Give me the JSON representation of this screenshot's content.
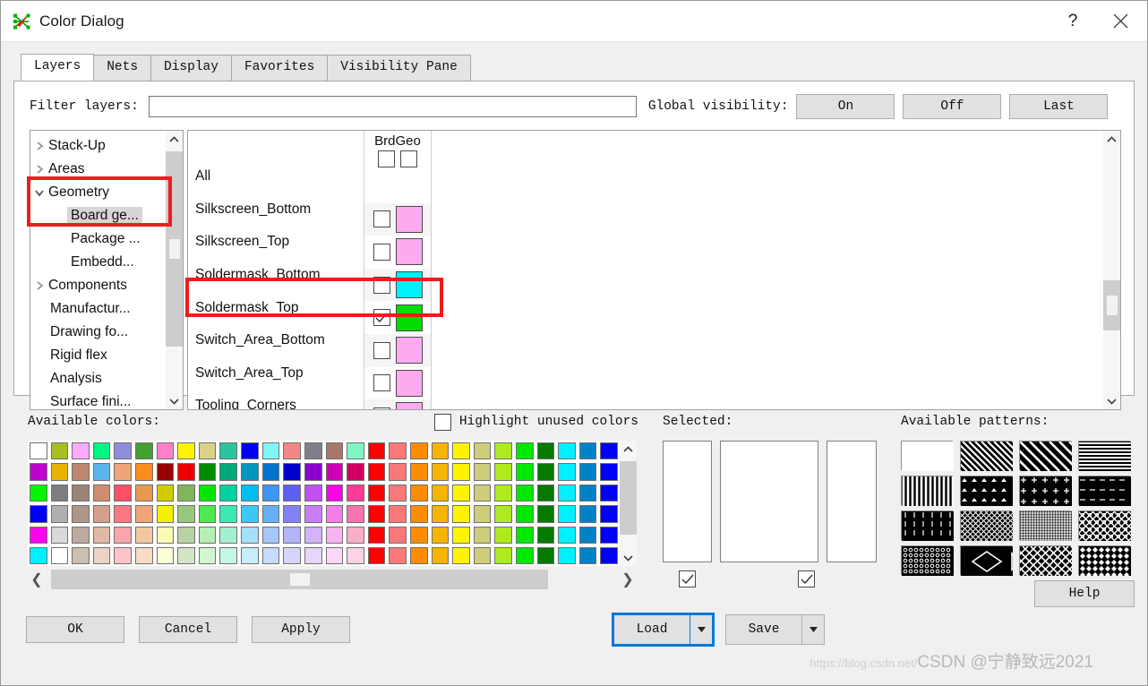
{
  "window": {
    "title": "Color Dialog",
    "app_icon": "network-icon",
    "help_button": "?",
    "close_button": "✕"
  },
  "tabs": [
    {
      "label": "Layers",
      "active": true
    },
    {
      "label": "Nets",
      "active": false
    },
    {
      "label": "Display",
      "active": false
    },
    {
      "label": "Favorites",
      "active": false
    },
    {
      "label": "Visibility Pane",
      "active": false
    }
  ],
  "filter": {
    "label": "Filter layers:",
    "value": "",
    "placeholder": ""
  },
  "global_visibility": {
    "label": "Global visibility:",
    "buttons": [
      "On",
      "Off",
      "Last"
    ]
  },
  "tree": {
    "items": [
      {
        "label": "Stack-Up",
        "level": 0,
        "expander": "collapsed",
        "selected": false
      },
      {
        "label": "Areas",
        "level": 0,
        "expander": "collapsed",
        "selected": false
      },
      {
        "label": "Geometry",
        "level": 0,
        "expander": "expanded",
        "selected": false
      },
      {
        "label": "Board ge...",
        "level": 1,
        "expander": "none",
        "selected": true
      },
      {
        "label": "Package ...",
        "level": 1,
        "expander": "none",
        "selected": false
      },
      {
        "label": "Embedd...",
        "level": 1,
        "expander": "none",
        "selected": false
      },
      {
        "label": "Components",
        "level": 0,
        "expander": "collapsed",
        "selected": false
      },
      {
        "label": "Manufactur...",
        "level": 0,
        "expander": "none",
        "selected": false
      },
      {
        "label": "Drawing fo...",
        "level": 0,
        "expander": "none",
        "selected": false
      },
      {
        "label": "Rigid flex",
        "level": 0,
        "expander": "none",
        "selected": false
      },
      {
        "label": "Analysis",
        "level": 0,
        "expander": "none",
        "selected": false
      },
      {
        "label": "Surface fini...",
        "level": 0,
        "expander": "none",
        "selected": false
      }
    ]
  },
  "layer_table": {
    "column_header": "BrdGeo",
    "header_checkboxes": [
      false,
      false
    ],
    "rows": [
      {
        "name": "All",
        "checked": null,
        "color": null,
        "highlighted": false
      },
      {
        "name": "Silkscreen_Bottom",
        "checked": false,
        "color": "#FFAAF0",
        "highlighted": false
      },
      {
        "name": "Silkscreen_Top",
        "checked": false,
        "color": "#FFAAF0",
        "highlighted": false
      },
      {
        "name": "Soldermask_Bottom",
        "checked": false,
        "color": "#00F0FF",
        "highlighted": false
      },
      {
        "name": "Soldermask_Top",
        "checked": true,
        "color": "#00DD00",
        "highlighted": true
      },
      {
        "name": "Switch_Area_Bottom",
        "checked": false,
        "color": "#FFAAF0",
        "highlighted": false
      },
      {
        "name": "Switch_Area_Top",
        "checked": false,
        "color": "#FFAAF0",
        "highlighted": false
      },
      {
        "name": "Tooling_Corners",
        "checked": false,
        "color": "#FFAAF0",
        "highlighted": false
      }
    ]
  },
  "available_colors": {
    "label": "Available colors:",
    "highlight_unused_label": "Highlight unused colors",
    "highlight_unused_checked": false,
    "palette_rows": [
      [
        "#FFFFFF",
        "#A9BE23",
        "#FFAAFF",
        "#00F582",
        "#8E8EDC",
        "#44A033",
        "#FF7FC8",
        "#FFF500",
        "#D9D188",
        "#2CC39E",
        "#0000F5",
        "#7FF5F5",
        "#F28787",
        "#7F7F8C",
        "#A8776B",
        "#7FF5C4",
        "#FF0000",
        "#F97878",
        "#FF8C00",
        "#F5B400",
        "#FFF500",
        "#CFCC7A",
        "#AEEB1E",
        "#00E800",
        "#007A00",
        "#00F0FF",
        "#0082C8",
        "#0000F5"
      ],
      [
        "#BE00D1",
        "#E8B400",
        "#BE8870",
        "#5BB4EB",
        "#EFA578",
        "#FF8C1E",
        "#9B0000",
        "#EE0000",
        "#008C00",
        "#00A87A",
        "#0096BE",
        "#0073D1",
        "#0000CD",
        "#8C00D1",
        "#CF00B4",
        "#D1005F",
        "#FF0000",
        "#F97878",
        "#FF8C00",
        "#F5B400",
        "#FFF500",
        "#CFCC7A",
        "#AEEB1E",
        "#00E800",
        "#007A00",
        "#00F0FF",
        "#0082C8",
        "#0000F5"
      ],
      [
        "#00F500",
        "#7D7D82",
        "#9B8278",
        "#D18C70",
        "#FF4F66",
        "#E8994F",
        "#D1CC00",
        "#82B45B",
        "#00E800",
        "#00D1A0",
        "#00BEF5",
        "#3C96F5",
        "#5F5FF5",
        "#C450F5",
        "#FF00E8",
        "#FF3C96",
        "#FF0000",
        "#F97878",
        "#FF8C00",
        "#F5B400",
        "#FFF500",
        "#CFCC7A",
        "#AEEB1E",
        "#00E800",
        "#007A00",
        "#00F0FF",
        "#0082C8",
        "#0000F5"
      ],
      [
        "#0000F5",
        "#AFAFAF",
        "#AE9688",
        "#D4A08C",
        "#F97882",
        "#EFA578",
        "#F5EF00",
        "#96C87D",
        "#4FE84F",
        "#3CE8B4",
        "#3CC8F5",
        "#69AFF5",
        "#8282F5",
        "#C87DF5",
        "#F57DE8",
        "#F573AF",
        "#FF0000",
        "#F97878",
        "#FF8C00",
        "#F5B400",
        "#FFF500",
        "#CFCC7A",
        "#AEEB1E",
        "#00E800",
        "#007A00",
        "#00F0FF",
        "#0082C8",
        "#0000F5"
      ],
      [
        "#FF00EE",
        "#D9D9D9",
        "#BCAB9E",
        "#E0B9A5",
        "#F9A5AA",
        "#F2C8A0",
        "#FAFAB4",
        "#B9D1A5",
        "#B4EFB4",
        "#A5EFD1",
        "#A5E0F9",
        "#A5C8F9",
        "#B4B4F9",
        "#D1B4F9",
        "#F9B4EF",
        "#FAAFC8",
        "#FF0000",
        "#F97878",
        "#FF8C00",
        "#F5B400",
        "#FFF500",
        "#CFCC7A",
        "#AEEB1E",
        "#00E800",
        "#007A00",
        "#00F0FF",
        "#0082C8",
        "#0000F5"
      ],
      [
        "#00F0FF",
        "#FFFFFF",
        "#CCBFAF",
        "#EDD2C6",
        "#FBC4C9",
        "#F7DCC4",
        "#FDFDD6",
        "#D2E6C6",
        "#D1F7D1",
        "#C6F7E6",
        "#C6EDFB",
        "#C6DCFB",
        "#D6D6FB",
        "#E6D6FB",
        "#FBD6F7",
        "#FBD2E6",
        "#FF0000",
        "#F97878",
        "#FF8C00",
        "#F5B400",
        "#FFF500",
        "#CFCC7A",
        "#AEEB1E",
        "#00E800",
        "#007A00",
        "#00F0FF",
        "#0082C8",
        "#0000F5"
      ]
    ]
  },
  "selected": {
    "label": "Selected:",
    "boxes": [
      {
        "color": "#FFFFFF",
        "checkbox": true
      },
      {
        "color": "#FFFFFF",
        "checkbox": null
      },
      {
        "color": "#FFFFFF",
        "checkbox": true
      }
    ]
  },
  "available_patterns": {
    "label": "Available patterns:",
    "patterns": [
      "solid",
      "diag-stripe-back",
      "diag-stripe-wide",
      "horiz-lines",
      "vert-lines",
      "triangles",
      "plus-dots",
      "dashes",
      "ticks",
      "fine-diamond-mesh",
      "fine-grid",
      "dot-diamond",
      "small-circles",
      "big-diamond",
      "cross-hatch-diamond",
      "checker-diamond"
    ]
  },
  "footer": {
    "ok": "OK",
    "cancel": "Cancel",
    "apply": "Apply",
    "load": "Load",
    "save": "Save",
    "help": "Help"
  },
  "watermark": {
    "prefix": "https://blog.csdn.net/",
    "text": "CSDN @宁静致远2021"
  },
  "annotations": {
    "accent_red": "#EE1C1C"
  }
}
